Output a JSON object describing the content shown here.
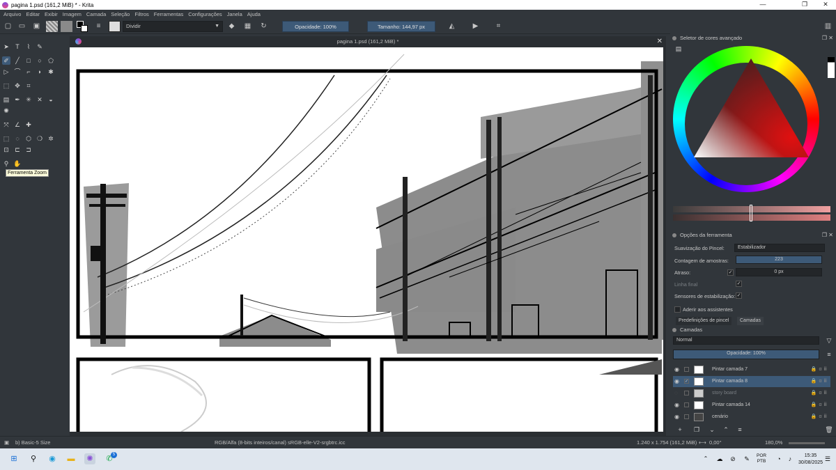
{
  "window": {
    "title": "pagina 1.psd (161,2 MiB) * - Krita",
    "minimize": "—",
    "maximize": "❐",
    "close": "✕"
  },
  "menu": [
    "Arquivo",
    "Editar",
    "Exibir",
    "Imagem",
    "Camada",
    "Seleção",
    "Filtros",
    "Ferramentas",
    "Configurações",
    "Janela",
    "Ajuda"
  ],
  "toolbar": {
    "blend_mode": "Dividir",
    "opacity": "Opacidade: 100%",
    "size_label": "Tamanho:",
    "size_value": "144,97 px"
  },
  "toolbox": {
    "tooltip": "Ferramenta Zoom"
  },
  "canvas": {
    "tab_title": "pagina 1.psd (161,2 MiB) *"
  },
  "color_selector": {
    "title": "Seletor de cores avançado"
  },
  "tool_options": {
    "title": "Opções da ferramenta",
    "smoothing_label": "Suavização do Pincel:",
    "smoothing_value": "Estabilizador",
    "sample_label": "Contagem de amostras:",
    "sample_value": "223",
    "delay_label": "Atraso:",
    "delay_value": "0 px",
    "finish_label": "Linha final",
    "sensors_label": "Sensores de estabilização:",
    "assistants_label": "Aderir aos assistentes"
  },
  "layers_panel": {
    "tabs": [
      "Predefinições de pincel",
      "Camadas"
    ],
    "title": "Camadas",
    "blend": "Normal",
    "opacity": "Opacidade: 100%",
    "layers": [
      {
        "name": "Pintar camada 7",
        "visible": true,
        "selected": false
      },
      {
        "name": "Pintar camada 8",
        "visible": true,
        "selected": true
      },
      {
        "name": "story board",
        "visible": false,
        "selected": false
      },
      {
        "name": "Pintar camada 14",
        "visible": true,
        "selected": false
      },
      {
        "name": "cenário",
        "visible": true,
        "selected": false
      }
    ]
  },
  "status": {
    "brush": "b) Basic-5 Size",
    "color_space": "RGB/Alfa (8-bits inteiros/canal)  sRGB-elle-V2-srgbtrc.icc",
    "dimensions": "1.240 x 1.754 (161,2 MiB)",
    "rotation": "0,00°",
    "zoom": "180,0%"
  },
  "taskbar": {
    "lang1": "POR",
    "lang2": "PTB",
    "time": "15:35",
    "date": "30/08/2025",
    "whatsapp_badge": "5"
  }
}
